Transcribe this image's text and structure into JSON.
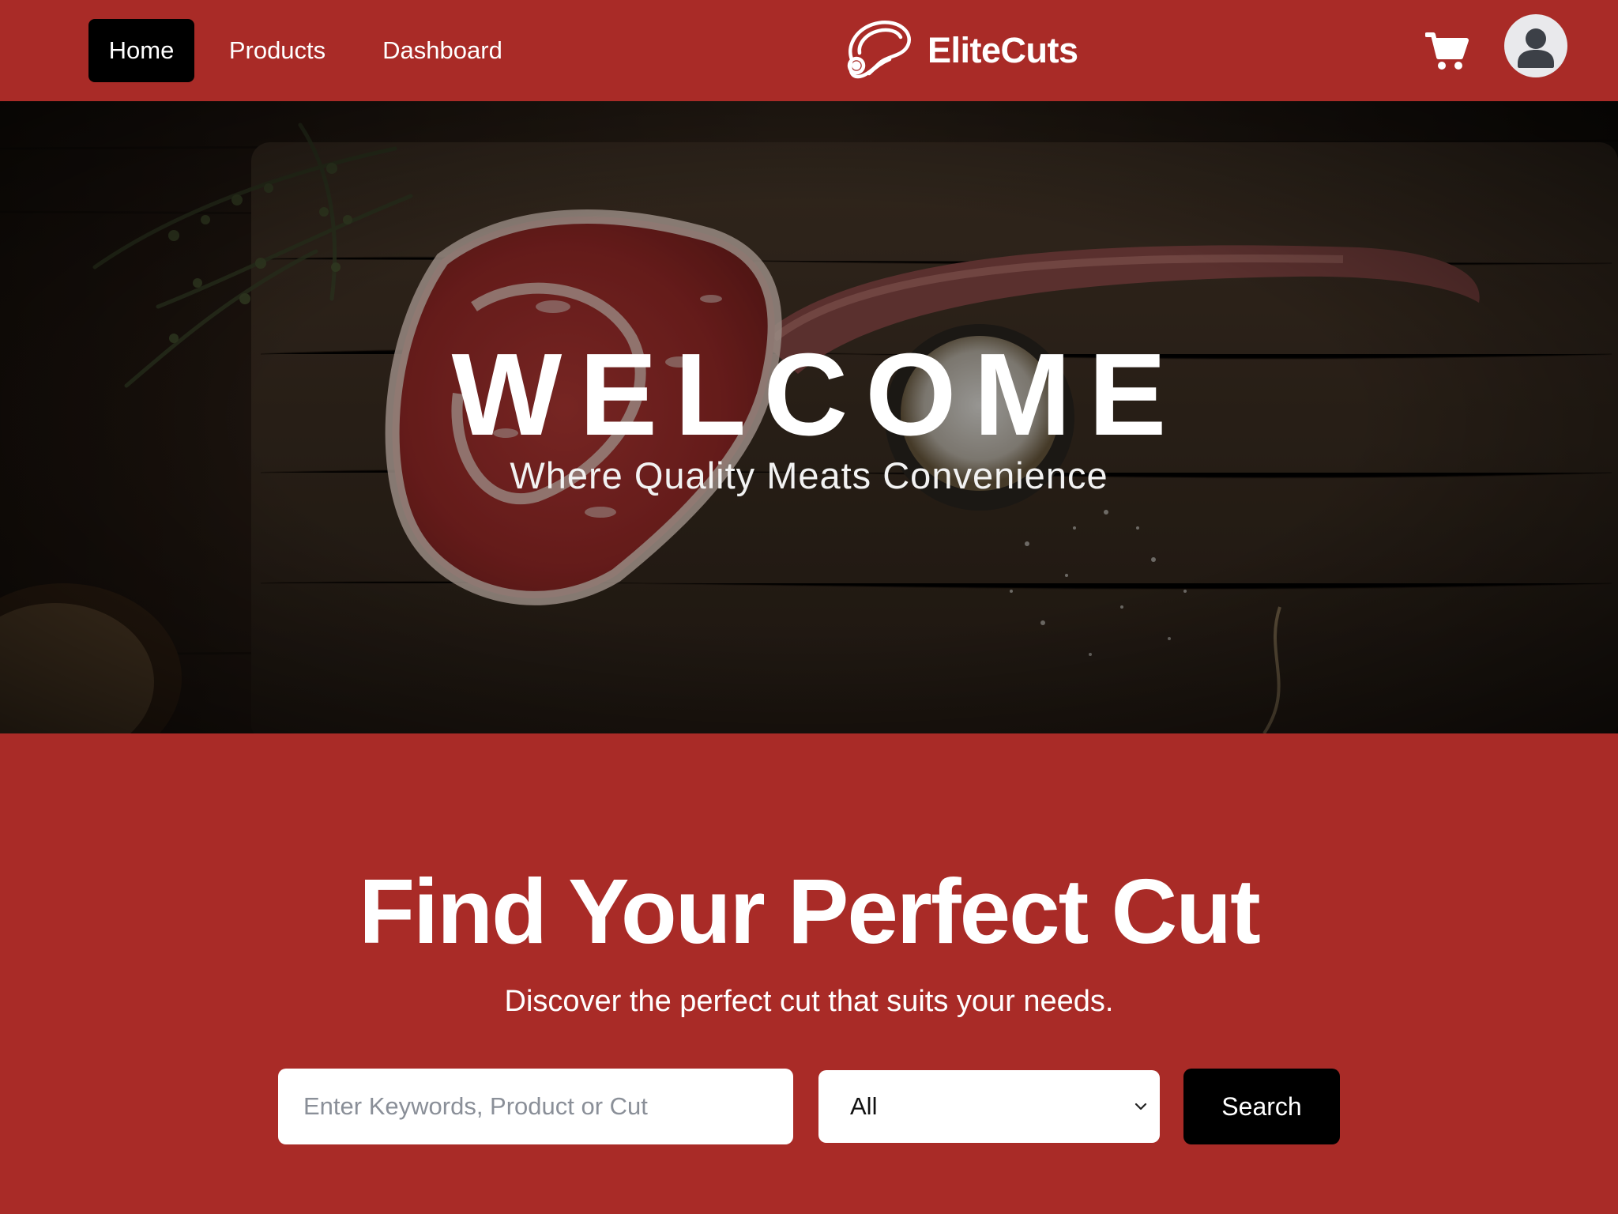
{
  "navbar": {
    "links": [
      {
        "label": "Home",
        "active": true
      },
      {
        "label": "Products",
        "active": false
      },
      {
        "label": "Dashboard",
        "active": false
      }
    ],
    "brand": {
      "name": "EliteCuts",
      "icon": "steak-icon"
    },
    "cart_icon": "shopping-cart-icon",
    "avatar_icon": "user-avatar-icon"
  },
  "hero": {
    "title": "WELCOME",
    "subtitle": "Where Quality Meats Convenience"
  },
  "search": {
    "title": "Find Your Perfect Cut",
    "subtitle": "Discover the perfect cut that suits your needs.",
    "input_placeholder": "Enter Keywords, Product or Cut",
    "input_value": "",
    "category_selected": "All",
    "button_label": "Search"
  },
  "colors": {
    "brand_red": "#a92b27",
    "black": "#000000",
    "white": "#ffffff"
  }
}
